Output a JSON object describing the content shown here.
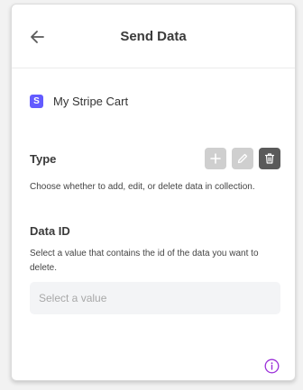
{
  "header": {
    "title": "Send Data",
    "back_icon": "arrow-left-icon"
  },
  "collection": {
    "badge_letter": "S",
    "badge_color": "#635bff",
    "name": "My Stripe Cart"
  },
  "type_section": {
    "label": "Type",
    "description": "Choose whether to add, edit, or delete data in collection.",
    "options": [
      {
        "icon": "plus-icon",
        "selected": false
      },
      {
        "icon": "pencil-icon",
        "selected": false
      },
      {
        "icon": "trash-icon",
        "selected": true
      }
    ]
  },
  "data_id_section": {
    "label": "Data ID",
    "description": "Select a value that contains the id of the data you want to delete.",
    "select_placeholder": "Select a value"
  },
  "footer": {
    "info_icon": "info-icon",
    "accent_color": "#9b30d9"
  }
}
